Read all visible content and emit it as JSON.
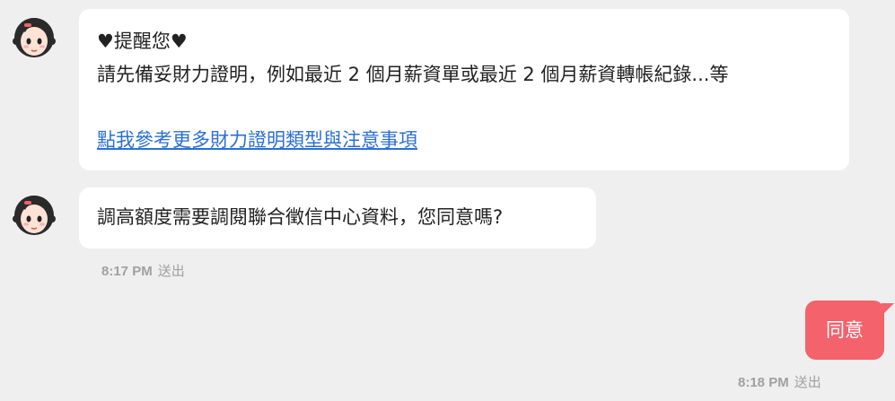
{
  "messages": [
    {
      "sender": "bot",
      "lines": [
        "♥提醒您♥",
        "請先備妥財力證明，例如最近 2 個月薪資單或最近 2 個月薪資轉帳紀錄...等"
      ],
      "link_text": "點我參考更多財力證明類型與注意事項"
    },
    {
      "sender": "bot",
      "text": "調高額度需要調閱聯合徵信中心資料，您同意嗎?",
      "time": "8:17 PM",
      "status": "送出"
    },
    {
      "sender": "user",
      "text": "同意",
      "time": "8:18 PM",
      "status": "送出"
    }
  ],
  "colors": {
    "background": "#efefef",
    "bot_bubble": "#ffffff",
    "user_bubble": "#f4626b",
    "link": "#2b6fd6",
    "meta_text": "#a0a0a0"
  },
  "icons": {
    "avatar": "bot-avatar-girl-icon"
  }
}
